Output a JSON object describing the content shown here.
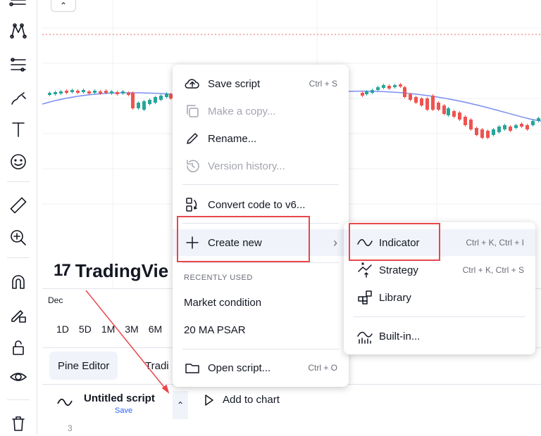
{
  "main_menu": {
    "items": [
      {
        "label": "Save script",
        "shortcut": "Ctrl + S",
        "icon": "cloud-upload-icon",
        "enabled": true
      },
      {
        "label": "Make a copy...",
        "shortcut": "",
        "icon": "copy-icon",
        "enabled": false
      },
      {
        "label": "Rename...",
        "shortcut": "",
        "icon": "pencil-icon",
        "enabled": true
      },
      {
        "label": "Version history...",
        "shortcut": "",
        "icon": "history-icon",
        "enabled": false
      },
      {
        "label": "Convert code to v6...",
        "shortcut": "",
        "icon": "convert-icon",
        "enabled": true
      },
      {
        "label": "Create new",
        "shortcut": "",
        "icon": "plus-icon",
        "enabled": true,
        "submenu_arrow": "›"
      }
    ],
    "recently_used_header": "RECENTLY USED",
    "recent": [
      "Market condition",
      "20 MA PSAR"
    ],
    "open_script": {
      "label": "Open script...",
      "shortcut": "Ctrl + O",
      "icon": "folder-icon"
    }
  },
  "sub_menu": {
    "items": [
      {
        "label": "Indicator",
        "shortcut": "Ctrl + K, Ctrl + I",
        "icon": "indicator-icon"
      },
      {
        "label": "Strategy",
        "shortcut": "Ctrl + K, Ctrl + S",
        "icon": "strategy-icon"
      },
      {
        "label": "Library",
        "shortcut": "",
        "icon": "library-icon"
      },
      {
        "label": "Built-in...",
        "shortcut": "",
        "icon": "builtin-icon"
      }
    ]
  },
  "chart": {
    "time_label": "Dec",
    "periods": [
      "1D",
      "5D",
      "1M",
      "3M",
      "6M"
    ],
    "logo_text": "TradingVie",
    "logo_mark": "17",
    "collapse_glyph": "⌃"
  },
  "bottom": {
    "pine_editor_tab": "Pine Editor",
    "trading_tab": "Tradi",
    "script_name": "Untitled script",
    "script_save": "Save",
    "chevron": "⌃",
    "add_to_chart": "Add to chart",
    "line_number": "3"
  },
  "colors": {
    "accent": "#2962ff",
    "highlight_box": "#e8474b",
    "bull": "#26a69a",
    "bear": "#ef5350",
    "ma_line": "#7b8ff0"
  }
}
